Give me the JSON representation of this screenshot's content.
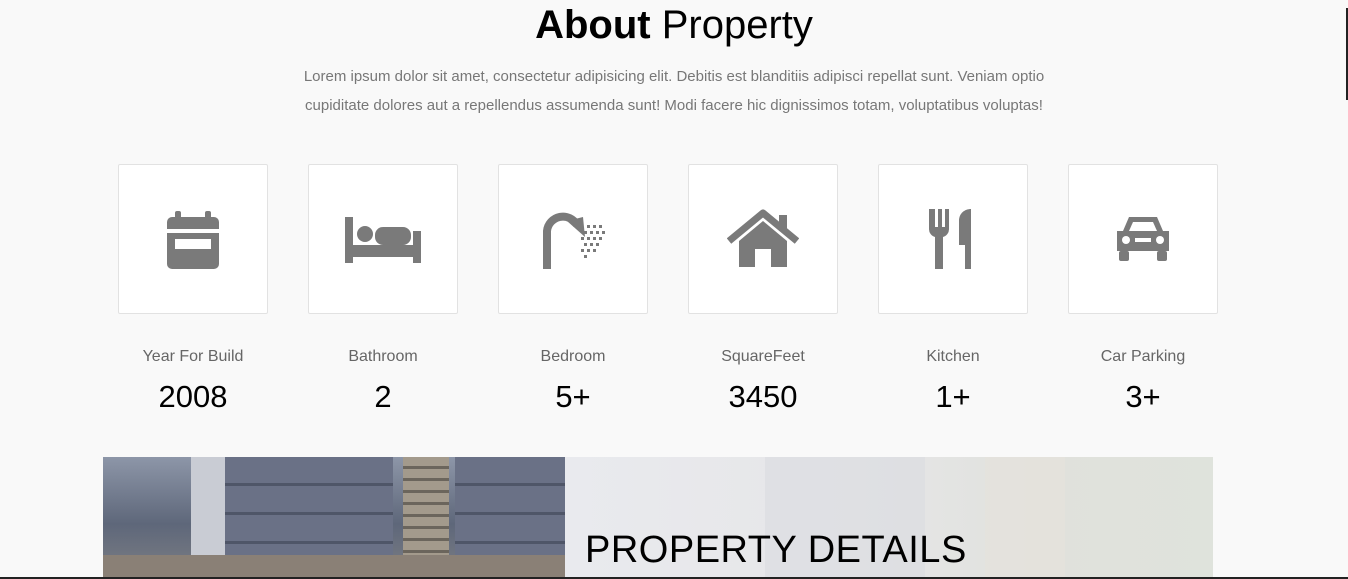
{
  "heading": {
    "bold": "About",
    "light": "Property"
  },
  "intro": "Lorem ipsum dolor sit amet, consectetur adipisicing elit. Debitis est blanditiis adipisci repellat sunt. Veniam optio cupiditate dolores aut a repellendus assumenda sunt! Modi facere hic dignissimos totam, voluptatibus voluptas!",
  "icon_color": "#7a7a7a",
  "features": [
    {
      "icon": "calendar-icon",
      "label": "Year For Build",
      "value": "2008"
    },
    {
      "icon": "bed-icon",
      "label": "Bathroom",
      "value": "2"
    },
    {
      "icon": "shower-icon",
      "label": "Bedroom",
      "value": "5+"
    },
    {
      "icon": "home-icon",
      "label": "SquareFeet",
      "value": "3450"
    },
    {
      "icon": "utensils-icon",
      "label": "Kitchen",
      "value": "1+"
    },
    {
      "icon": "car-icon",
      "label": "Car Parking",
      "value": "3+"
    }
  ],
  "banner": {
    "title": "PROPERTY DETAILS"
  }
}
